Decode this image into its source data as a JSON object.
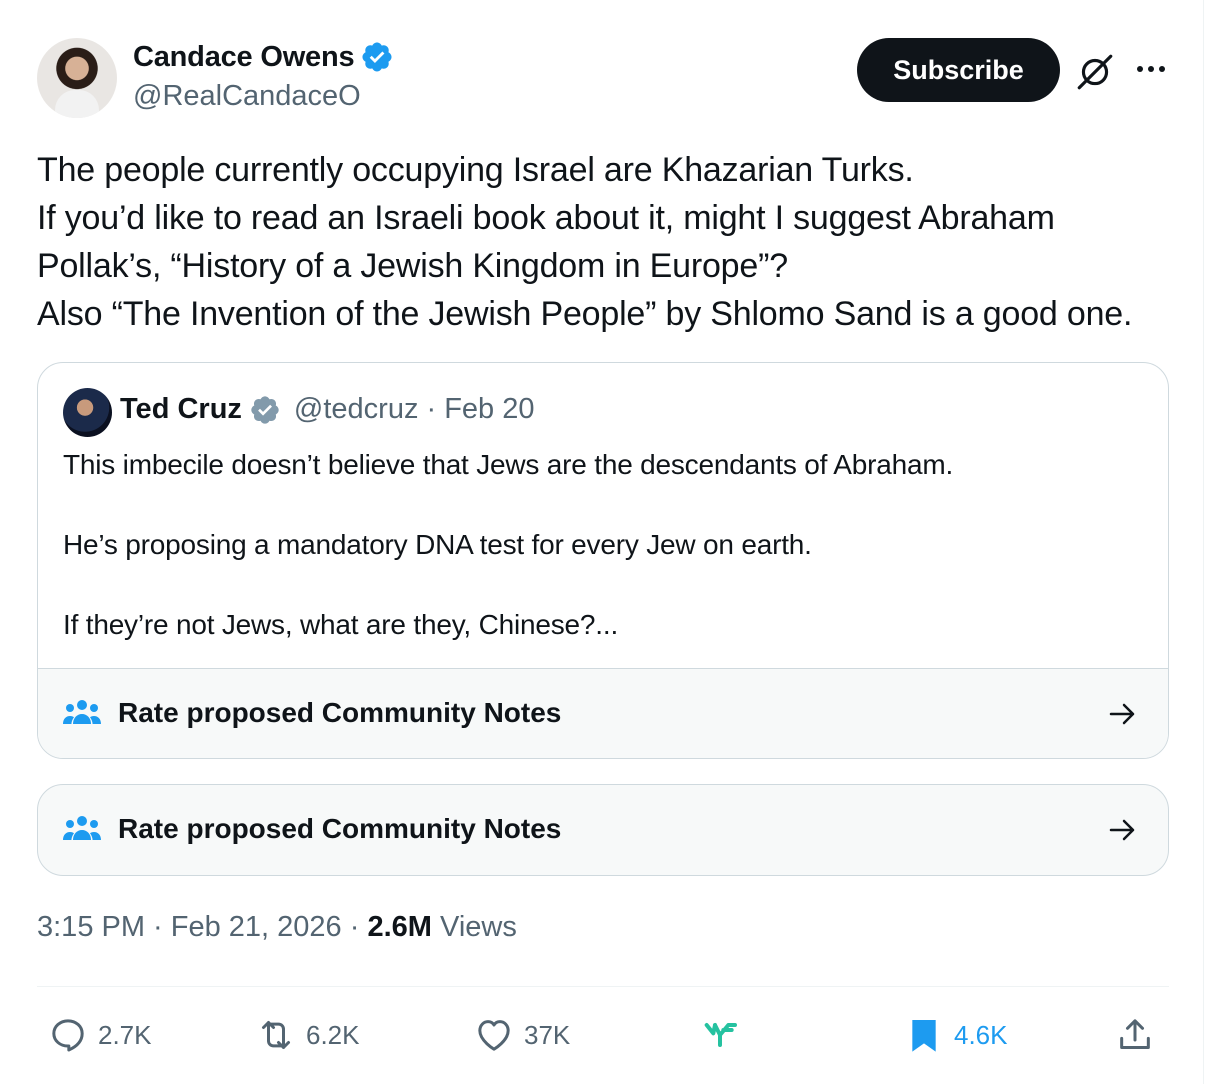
{
  "author": {
    "name": "Candace Owens",
    "handle": "@RealCandaceO",
    "verified": true,
    "verified_color": "#1d9bf0"
  },
  "header": {
    "subscribe_label": "Subscribe",
    "icons": [
      "grok-slash-icon",
      "more-icon"
    ]
  },
  "tweet": {
    "lines": [
      "The people currently occupying Israel are Khazarian Turks.",
      "If you’d like to read an Israeli book about it, might I suggest Abraham",
      "Pollak’s, “History of a Jewish Kingdom in Europe”?",
      "Also “The Invention of the Jewish People” by Shlomo Sand is a good one."
    ]
  },
  "quote": {
    "name": "Ted Cruz",
    "verified_color": "#829aab",
    "meta": "@tedcruz · Feb 20",
    "paragraphs": [
      "This imbecile doesn’t believe that Jews are the descendants of Abraham.",
      "He’s proposing a mandatory DNA test for every Jew on earth.",
      "If they’re not Jews, what are they, Chinese?..."
    ],
    "notes_label": "Rate proposed Community Notes"
  },
  "notes": {
    "label": "Rate proposed Community Notes"
  },
  "timestamp": {
    "time_date": "3:15 PM · Feb 21, 2026 · ",
    "views_count": "2.6M",
    "views_label": " Views"
  },
  "actions": {
    "replies": "2.7K",
    "reposts": "6.2K",
    "likes": "37K",
    "bookmarks": "4.6K",
    "accent": "#1d9bf0",
    "grok_color": "#25c2a0"
  }
}
